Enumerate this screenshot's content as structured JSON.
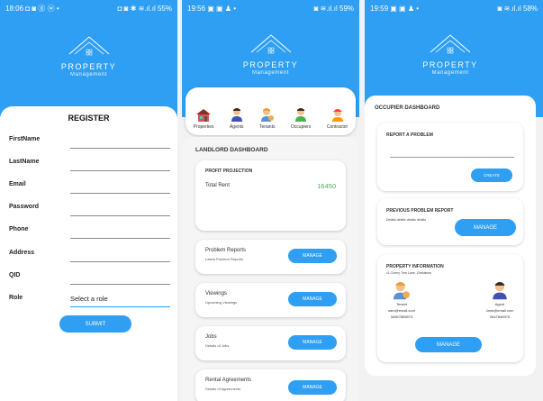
{
  "screens": {
    "register": {
      "status_time": "18:06",
      "status_icons": "◘ ◙ ⓖ ⓦ •",
      "status_right": "◘ ◙ ✱ ≋.ıl.ıl 55%",
      "brand": "PROPERTY",
      "brand_sub": "Management",
      "title": "REGISTER",
      "fields": [
        {
          "label": "FirstName"
        },
        {
          "label": "LastName"
        },
        {
          "label": "Email"
        },
        {
          "label": "Password"
        },
        {
          "label": "Phone"
        },
        {
          "label": "Address"
        },
        {
          "label": "QID"
        }
      ],
      "role_label": "Role",
      "role_value": "Select a role",
      "submit_label": "SUBMIT"
    },
    "landlord": {
      "status_time": "19:56",
      "status_icons": "▣ ▣ ♟ •",
      "status_right": "◙ ≋.ıl.ıl 59%",
      "brand": "PROPERTY",
      "brand_sub": "Management",
      "icons": [
        {
          "label": "Properties",
          "icon": "house-icon"
        },
        {
          "label": "Agents",
          "icon": "agent-icon"
        },
        {
          "label": "Tenants",
          "icon": "tenant-icon"
        },
        {
          "label": "Occupiers",
          "icon": "occupier-icon"
        },
        {
          "label": "Contractor",
          "icon": "contractor-icon"
        }
      ],
      "dashboard_title": "LANDLORD DASHBOARD",
      "profit": {
        "title": "PROFIT PROJECTION",
        "label": "Total Rent",
        "value": "16450"
      },
      "cards": [
        {
          "title": "Problem Reports",
          "sub": "Latest Problem Reports",
          "button": "MANAGE"
        },
        {
          "title": "Viewings",
          "sub": "Upcoming Viewings",
          "button": "MANAGE"
        },
        {
          "title": "Jobs",
          "sub": "Details of Jobs",
          "button": "MANAGE"
        },
        {
          "title": "Rental Agreements",
          "sub": "Details of Agreements",
          "button": "MANAGE"
        }
      ]
    },
    "occupier": {
      "status_time": "19:59",
      "status_icons": "▣ ▣ ♟ •",
      "status_right": "◙ ≋.ıl.ıl 58%",
      "brand": "PROPERTY",
      "brand_sub": "Management",
      "dashboard_title": "OCCUPIER DASHBOARD",
      "report": {
        "title": "REPORT A PROBLEM",
        "button": "CREATE"
      },
      "previous": {
        "title": "PREVIOUS PROBLEM REPORT",
        "sub": "Details details details details",
        "button": "MANAGE"
      },
      "info": {
        "title": "PROPERTY INFORMATION",
        "address": "11 Cherry Tree Lane, Zimbabwe",
        "tenant": {
          "role": "Tenant",
          "email": "sam@email.com",
          "phone": "34567865573"
        },
        "agent": {
          "role": "Agent",
          "email": "Jane@email.com",
          "phone": "2647846575"
        },
        "button": "MANAGE"
      }
    }
  },
  "colors": {
    "accent": "#2e9ff2",
    "rent_value": "#4caf50",
    "card_bg": "#ffffff"
  }
}
